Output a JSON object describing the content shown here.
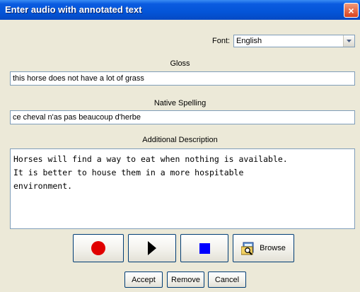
{
  "window": {
    "title": "Enter audio with annotated text",
    "close_symbol": "×"
  },
  "font": {
    "label": "Font:",
    "selected": "English"
  },
  "gloss": {
    "label": "Gloss",
    "value": "this horse does not have a lot of grass"
  },
  "native_spelling": {
    "label": "Native Spelling",
    "value": "ce cheval n'as pas beaucoup d'herbe"
  },
  "additional_description": {
    "label": "Additional Description",
    "value": "Horses will find a way to eat when nothing is available.\nIt is better to house them in a more hospitable\nenvironment."
  },
  "media_controls": {
    "record_icon": "record-icon",
    "play_icon": "play-icon",
    "stop_icon": "stop-icon",
    "browse_icon": "folder-search-icon",
    "browse_label": "Browse",
    "record_color": "#E00000",
    "stop_color": "#0000FF"
  },
  "actions": {
    "accept_label": "Accept",
    "remove_label": "Remove",
    "cancel_label": "Cancel"
  }
}
